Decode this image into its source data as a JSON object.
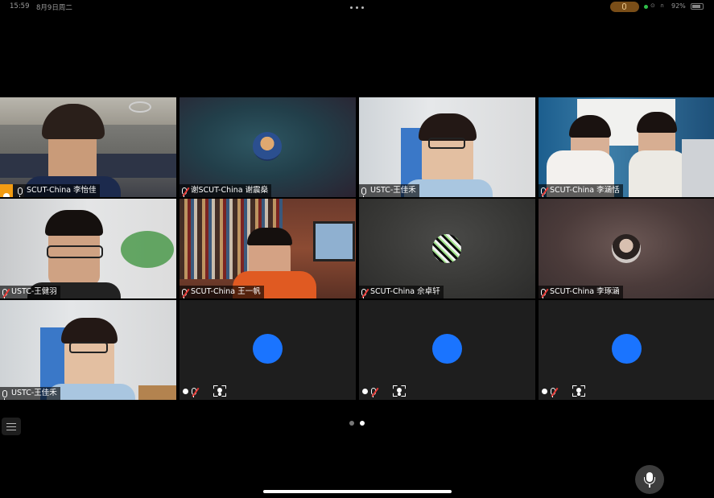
{
  "status_bar": {
    "time": "15:59",
    "date": "8月9日周二",
    "battery": "92%"
  },
  "colors": {
    "avatar_placeholder": "#1a74ff",
    "host_badge": "#f39c12",
    "mute_slash": "#e53935"
  },
  "participants": [
    {
      "name": "SCUT-China 李怡佳",
      "host": true,
      "mic": "on",
      "video": "camera"
    },
    {
      "name": "谢SCUT-China 谢震燊",
      "mic": "muted",
      "video": "avatar-photo"
    },
    {
      "name": "USTC-王佳禾",
      "mic": "on",
      "video": "camera"
    },
    {
      "name": "SCUT-China 李涵恬",
      "mic": "muted",
      "video": "camera"
    },
    {
      "name": "USTC-王健羽",
      "mic": "muted",
      "video": "camera"
    },
    {
      "name": "SCUT-China 王一帆",
      "mic": "muted",
      "video": "camera"
    },
    {
      "name": "SCUT-China 佘卓轩",
      "mic": "muted",
      "video": "avatar-photo"
    },
    {
      "name": "SCUT-China 李琢涵",
      "mic": "muted",
      "video": "avatar-photo"
    },
    {
      "name": "USTC-王佳禾",
      "mic": "on",
      "video": "camera"
    },
    {
      "name": "",
      "mic": "muted",
      "video": "blue-placeholder"
    },
    {
      "name": "",
      "mic": "muted",
      "video": "blue-placeholder"
    },
    {
      "name": "",
      "mic": "muted",
      "video": "blue-placeholder"
    }
  ],
  "pagination": {
    "current": 2,
    "total": 2
  },
  "icons": {
    "more": "more-dots-icon",
    "list": "participant-list-icon",
    "mic": "microphone-icon",
    "frame": "focus-frame-icon"
  }
}
